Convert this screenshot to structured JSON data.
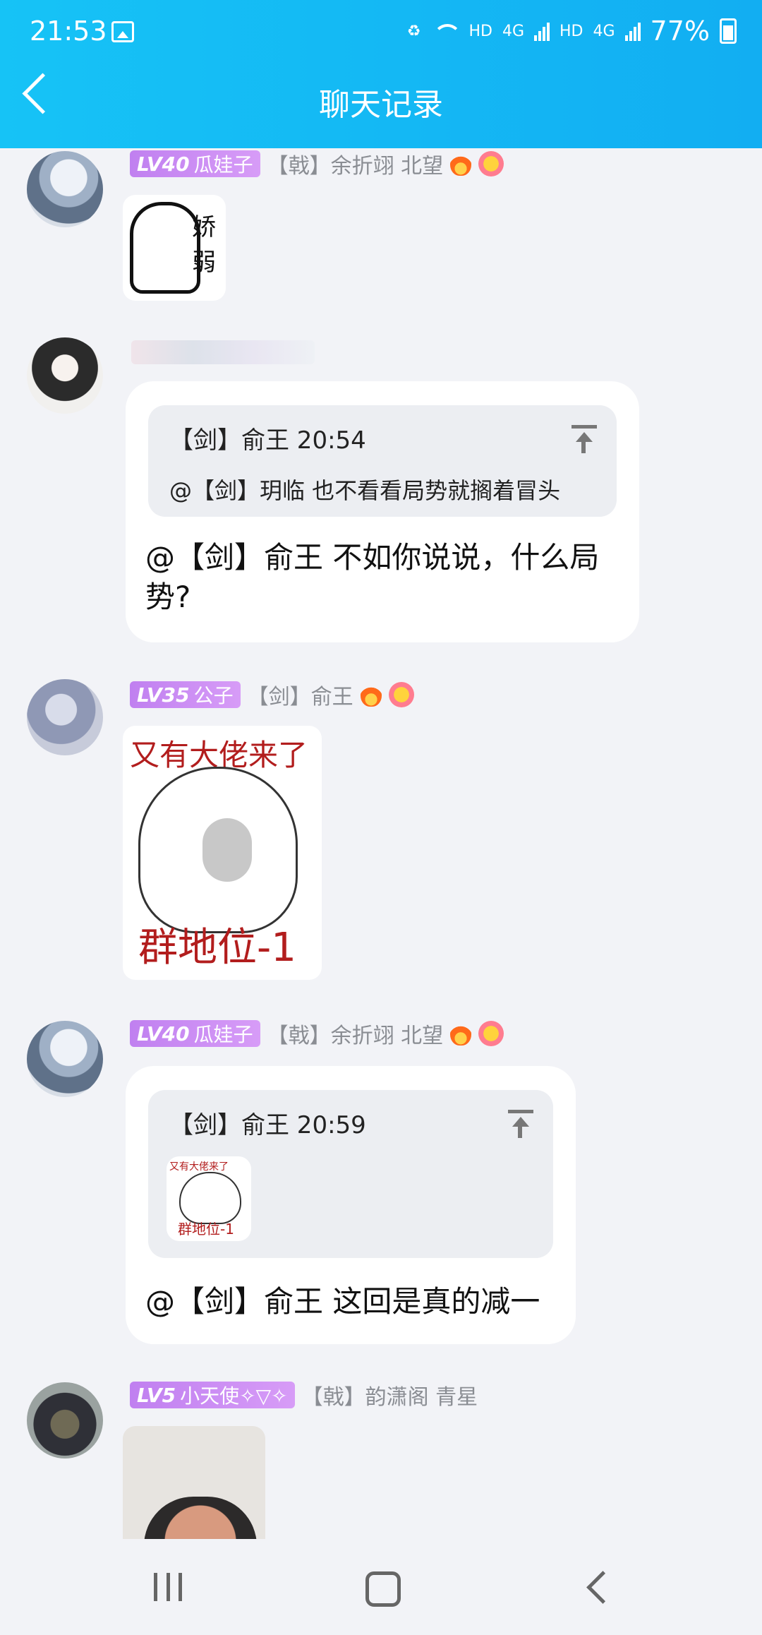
{
  "status_bar": {
    "time": "21:53",
    "net1": "HD",
    "net2": "4G",
    "net3": "HD",
    "net4": "4G",
    "battery": "77%"
  },
  "header": {
    "title": "聊天记录"
  },
  "messages": [
    {
      "lv": "LV40",
      "nickname": "瓜娃子",
      "group_title": "【戟】余折翊 北望",
      "sticker_text": [
        "娇",
        "弱"
      ]
    },
    {
      "quote_head": "【剑】俞王 20:54",
      "quote_text": "@【剑】玥临 也不看看局势就搁着冒头",
      "text": "@【剑】俞王 不如你说说，什么局势?"
    },
    {
      "lv": "LV35",
      "nickname": "公子",
      "group_title": "【剑】俞王",
      "sticker_top": "又有大佬来了",
      "sticker_bottom": "群地位-1"
    },
    {
      "lv": "LV40",
      "nickname": "瓜娃子",
      "group_title": "【戟】余折翊 北望",
      "quote_head": "【剑】俞王 20:59",
      "quote_sticker_top": "又有大佬来了",
      "quote_sticker_bottom": "群地位-1",
      "text": "@【剑】俞王 这回是真的减一"
    },
    {
      "lv": "LV5",
      "nickname": "小天使✧▽✧",
      "group_title": "【戟】韵潇阁 青星"
    }
  ],
  "colors": {
    "header_start": "#16c3f6",
    "header_end": "#12aef2",
    "background": "#f2f3f7",
    "badge": "#c080f0"
  }
}
